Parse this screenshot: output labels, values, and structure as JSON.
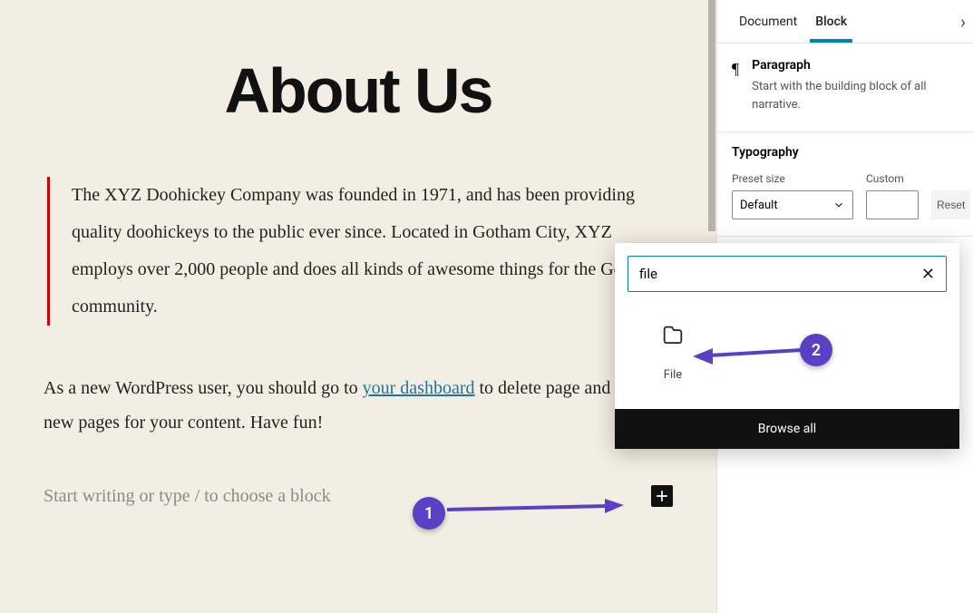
{
  "editor": {
    "title": "About Us",
    "quote": "The XYZ Doohickey Company was founded in 1971, and has been providing quality doohickeys to the public ever since. Located in Gotham City, XYZ employs over 2,000 people and does all kinds of awesome things for the Gotham community.",
    "body_before_link": "As a new WordPress user, you should go to ",
    "body_link_text": "your dashboard",
    "body_after_link": " to delete page and create new pages for your content. Have fun!",
    "placeholder": "Start writing or type / to choose a block"
  },
  "sidebar": {
    "tabs": {
      "document": "Document",
      "block": "Block"
    },
    "block_info": {
      "title": "Paragraph",
      "desc": "Start with the building block of all narrative."
    },
    "typography": {
      "panel_title": "Typography",
      "preset_label": "Preset size",
      "preset_value": "Default",
      "custom_label": "Custom",
      "reset": "Reset"
    }
  },
  "popover": {
    "search_value": "file",
    "result_label": "File",
    "browse_all": "Browse all"
  },
  "annotations": {
    "b1": "1",
    "b2": "2"
  }
}
